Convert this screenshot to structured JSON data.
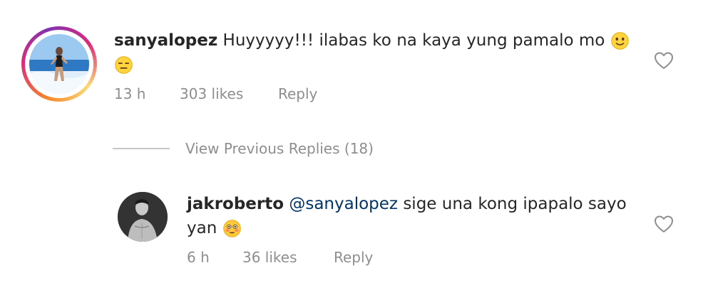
{
  "comment": {
    "username": "sanyalopez",
    "text": " Huyyyyy!!! ilabas ko na kaya yung pamalo mo ",
    "emojis": [
      "slightly-smiling-face-emoji",
      "expressionless-face-emoji"
    ],
    "time": "13 h",
    "likes": "303 likes",
    "reply_label": "Reply"
  },
  "view_previous": {
    "label": "View Previous Replies (18)"
  },
  "reply": {
    "username": "jakroberto",
    "mention": "@sanyalopez",
    "text_line1": " sige una kong ipapalo sayo",
    "text_line2": "yan ",
    "emojis": [
      "flushed-face-emoji"
    ],
    "time": "6 h",
    "likes": "36 likes",
    "reply_label": "Reply"
  },
  "colors": {
    "text": "#262626",
    "meta": "#8e8e8e",
    "mention": "#003569",
    "divider": "#c7c7c7"
  }
}
